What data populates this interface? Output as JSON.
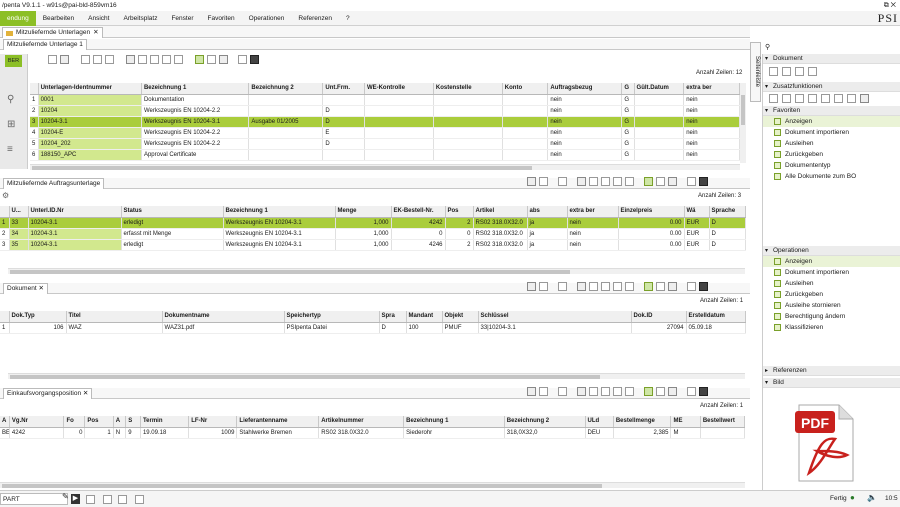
{
  "titlebar": {
    "title": "/penta V9.1.1 - w91s@pai-bld-859vm16",
    "controls": "⧉  ✕"
  },
  "menu": {
    "items": [
      "endung",
      "Bearbeiten",
      "Ansicht",
      "Arbeitsplatz",
      "Fenster",
      "Favoriten",
      "Operationen",
      "Referenzen",
      "?"
    ],
    "brand": "PSI"
  },
  "tabs": {
    "main_tab": "Mitzuliefernde Unterlagen",
    "sub_tab": "Mitzuliefernde Unterlage 1"
  },
  "panel1": {
    "count": "Anzahl Zeilen: 12",
    "flag": "BER",
    "columns": [
      "",
      "Unterlagen-Identnummer",
      "Bezeichnung 1",
      "Bezeichnung 2",
      "Unt.Frm.",
      "WE-Kontrolle",
      "Kostenstelle",
      "Konto",
      "Auftragsbezug",
      "G",
      "Gült.Datum",
      "extra ber"
    ],
    "rows": [
      [
        "1",
        "0001",
        "Dokumentation",
        "",
        "",
        "",
        "",
        "",
        "nein",
        "G",
        "",
        "nein"
      ],
      [
        "2",
        "10204",
        "Werkszeugnis EN 10204-2.2",
        "",
        "D",
        "",
        "",
        "",
        "nein",
        "G",
        "",
        "nein"
      ],
      [
        "3",
        "10204-3.1",
        "Werkszeugnis EN 10204-3.1",
        "Ausgabe 01/2005",
        "D",
        "",
        "",
        "",
        "nein",
        "G",
        "",
        "nein"
      ],
      [
        "4",
        "10204-E",
        "Werkszeugnis EN 10204-2.2",
        "",
        "E",
        "",
        "",
        "",
        "nein",
        "G",
        "",
        "nein"
      ],
      [
        "5",
        "10204_202",
        "Werkszeugnis EN 10204-2.2",
        "",
        "D",
        "",
        "",
        "",
        "nein",
        "G",
        "",
        "nein"
      ],
      [
        "6",
        "188150_APC",
        "Approval Certificate",
        "",
        "",
        "",
        "",
        "",
        "nein",
        "G",
        "",
        "nein"
      ]
    ]
  },
  "panel2": {
    "title": "Mitzuliefernde Auftragsunterlage",
    "count": "Anzahl Zeilen: 3",
    "columns": [
      "",
      "U...",
      "Unterl.ID.Nr",
      "Status",
      "Bezeichnung 1",
      "Menge",
      "EK-Bestell-Nr.",
      "Pos",
      "Artikel",
      "abs",
      "extra ber",
      "Einzelpreis",
      "Wä",
      "Sprache"
    ],
    "rows": [
      [
        "1",
        "33",
        "10204-3.1",
        "erledigt",
        "Werkszeugnis EN 10204-3.1",
        "1,000",
        "4242",
        "2",
        "RS02 318.0X32.0",
        "ja",
        "nein",
        "0.00",
        "EUR",
        "D"
      ],
      [
        "2",
        "34",
        "10204-3.1",
        "erfasst mit Menge",
        "Werkszeugnis EN 10204-3.1",
        "1,000",
        "0",
        "0",
        "RS02 318.0X32.0",
        "ja",
        "nein",
        "0.00",
        "EUR",
        "D"
      ],
      [
        "3",
        "35",
        "10204-3.1",
        "erledigt",
        "Werkszeugnis EN 10204-3.1",
        "1,000",
        "4246",
        "2",
        "RS02 318.0X32.0",
        "ja",
        "nein",
        "0.00",
        "EUR",
        "D"
      ]
    ]
  },
  "panel3": {
    "title": "Dokument",
    "count": "Anzahl Zeilen: 1",
    "columns": [
      "",
      "Dok.Typ",
      "Titel",
      "Dokumentname",
      "Speichertyp",
      "Spra",
      "Mandant",
      "Objekt",
      "Schlüssel",
      "Dok.ID",
      "Erstelldatum"
    ],
    "rows": [
      [
        "1",
        "106",
        "WAZ",
        "WAZ31.pdf",
        "PSIpenta Datei",
        "D",
        "100",
        "PMUF",
        "33|10204-3.1",
        "27094",
        "05.09.18"
      ]
    ]
  },
  "panel4": {
    "title": "Einkaufsvorgangsposition",
    "count": "Anzahl Zeilen: 1",
    "columns": [
      "A",
      "Vg.Nr",
      "Fo",
      "Pos",
      "A",
      "S",
      "Termin",
      "LF-Nr",
      "Lieferantenname",
      "Artikelnummer",
      "Bezeichnung 1",
      "Bezeichnung 2",
      "ULd",
      "Bestellmenge",
      "ME",
      "Bestellwert"
    ],
    "rows": [
      [
        "BE",
        "4242",
        "0",
        "1",
        "N",
        "9",
        "19.09.18",
        "1009",
        "Stahlwerke Bremen",
        "RS02 318.0X32.0",
        "Siederohr",
        "318,0X32,0",
        "DEU",
        "2,385",
        "M",
        ""
      ]
    ]
  },
  "rightpanel": {
    "vtab": "Seitenleiste",
    "sec_dokument": "Dokument",
    "sec_zusatz": "Zusatzfunktionen",
    "sec_favoriten": "Favoriten",
    "favoriten": [
      "Anzeigen",
      "Dokument importieren",
      "Ausleihen",
      "Zurückgeben",
      "Dokumententyp",
      "Alle Dokumente zum BO"
    ],
    "sec_operationen": "Operationen",
    "operationen": [
      "Anzeigen",
      "Dokument importieren",
      "Ausleihen",
      "Zurückgeben",
      "Ausleihe stornieren",
      "Berechtigung ändern",
      "Klassifizieren"
    ],
    "sec_referenzen": "Referenzen",
    "sec_bild": "Bild",
    "pdf_label": "PDF"
  },
  "statusbar": {
    "input_value": "PART",
    "status": "Fertig",
    "time": "10:5"
  },
  "colors": {
    "accent": "#8cbf26",
    "selection": "#aacd3c",
    "pdf_red": "#c8211d"
  }
}
